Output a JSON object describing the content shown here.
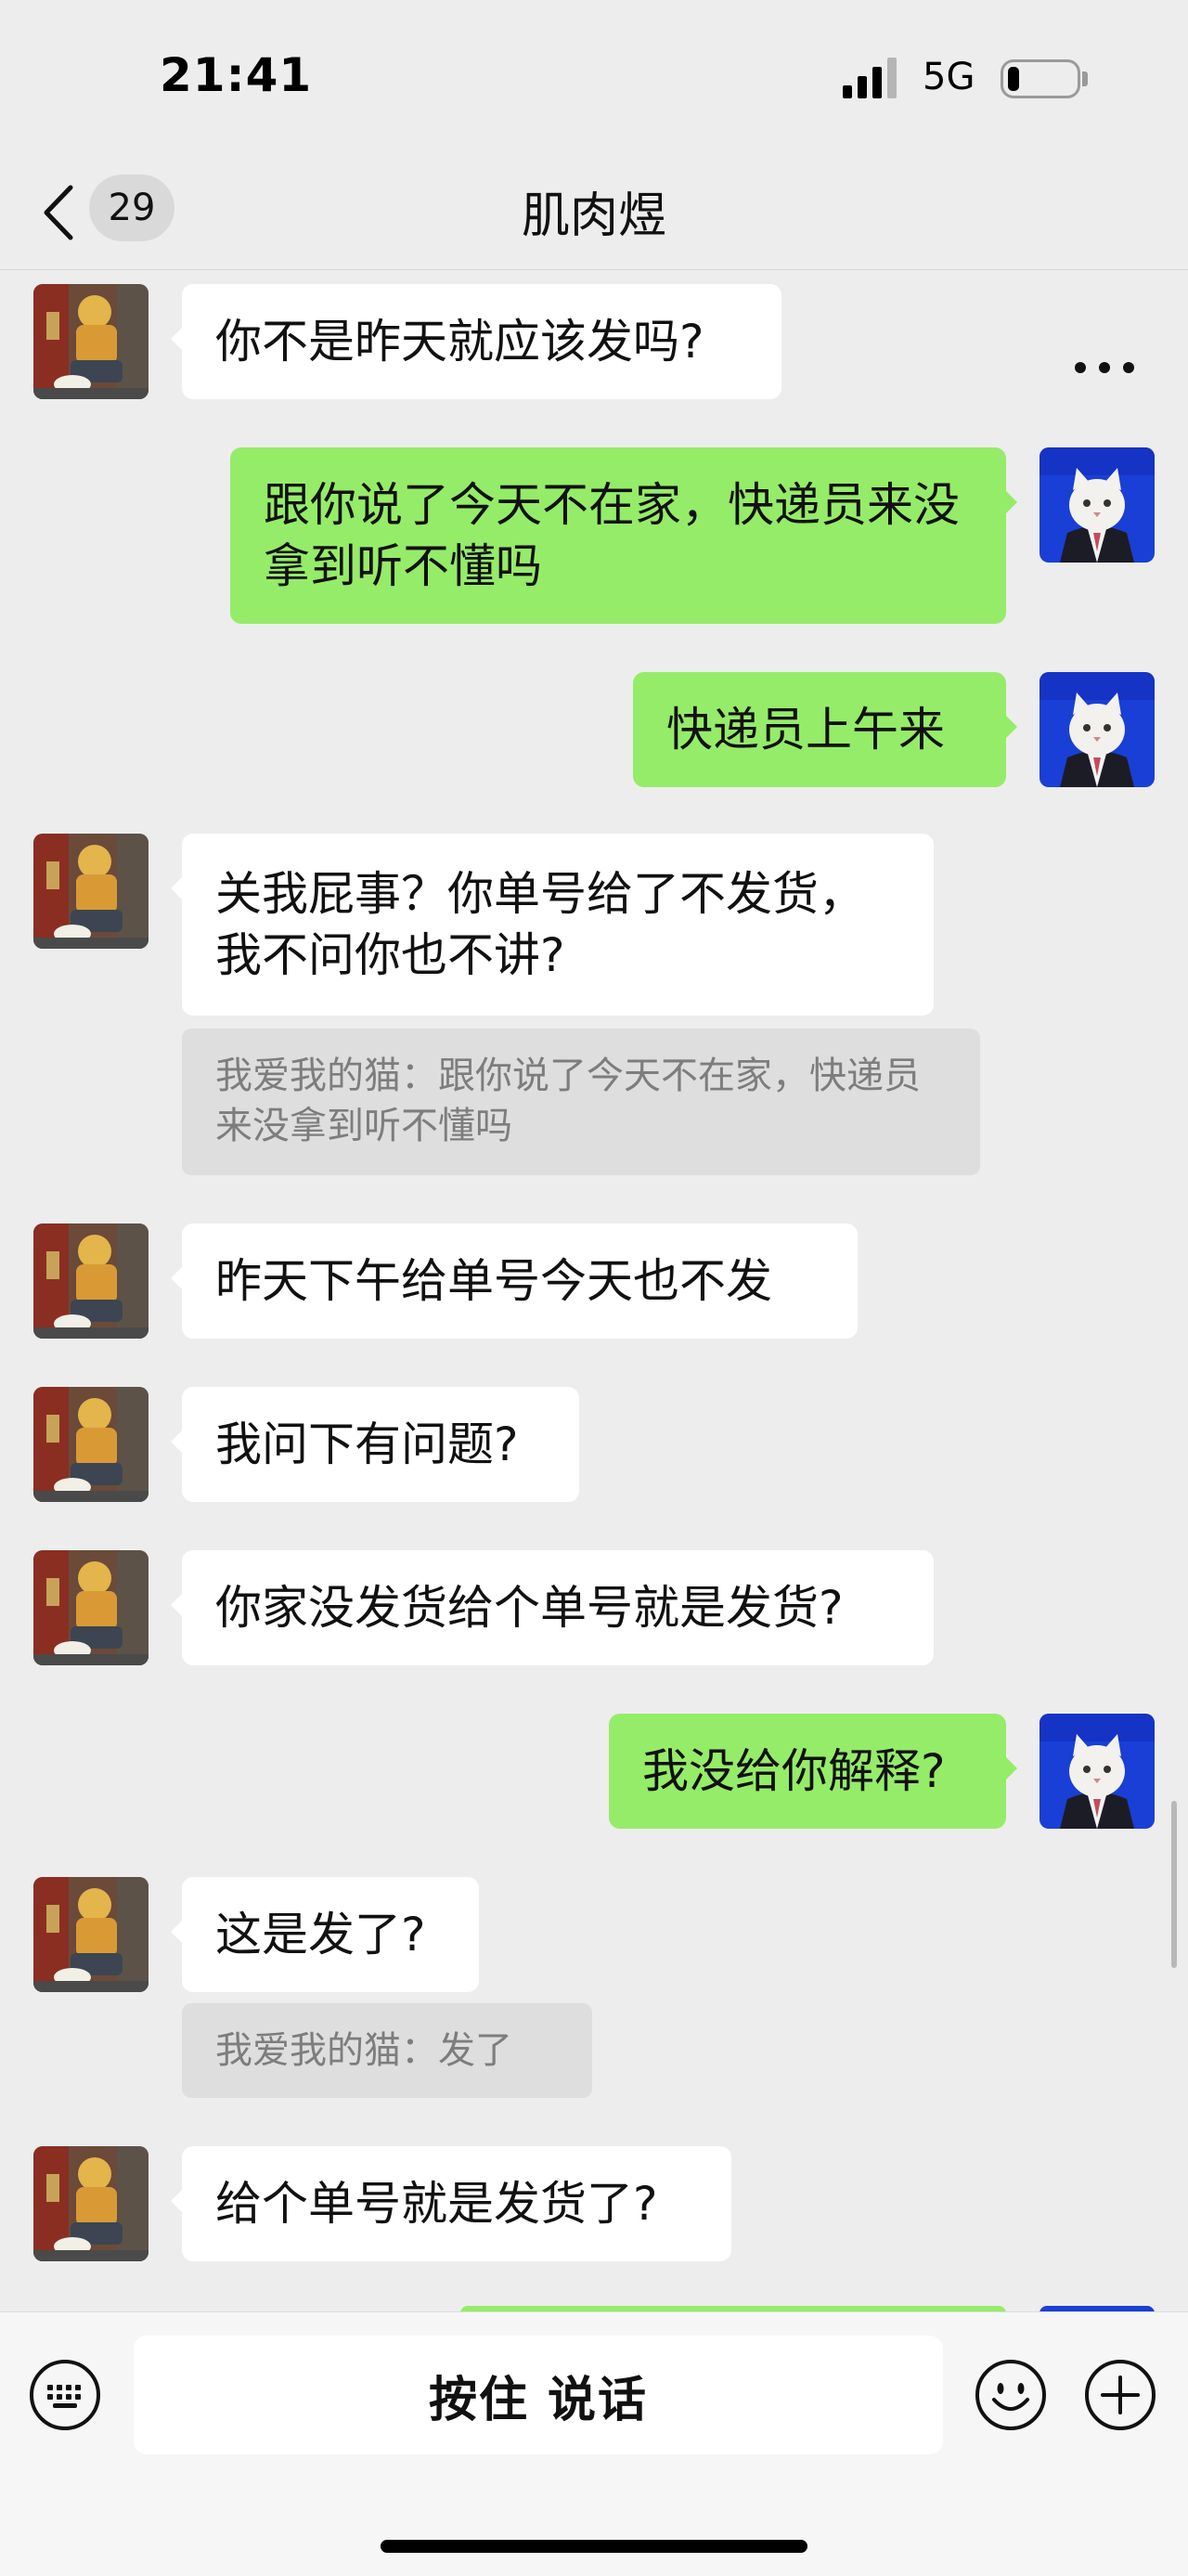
{
  "status_bar": {
    "time": "21:41",
    "network": "5G"
  },
  "nav": {
    "title": "肌肉煜",
    "unread_count": "29"
  },
  "messages": [
    {
      "side": "in",
      "text": "你不是昨天就应该发吗?"
    },
    {
      "side": "out",
      "text": "跟你说了今天不在家，快递员来没拿到听不懂吗"
    },
    {
      "side": "out",
      "text": "快递员上午来"
    },
    {
      "side": "in",
      "text": "关我屁事？你单号给了不发货，我不问你也不讲?",
      "quote": "我爱我的猫：跟你说了今天不在家，快递员来没拿到听不懂吗"
    },
    {
      "side": "in",
      "text": "昨天下午给单号今天也不发"
    },
    {
      "side": "in",
      "text": "我问下有问题?"
    },
    {
      "side": "in",
      "text": "你家没发货给个单号就是发货?"
    },
    {
      "side": "out",
      "text": "我没给你解释?"
    },
    {
      "side": "in",
      "text": "这是发了?",
      "quote": "我爱我的猫：发了"
    },
    {
      "side": "in",
      "text": "给个单号就是发货了?"
    }
  ],
  "input_bar": {
    "hold_to_talk": "按住 说话"
  },
  "colors": {
    "background": "#ededed",
    "outgoing_bubble": "#95ec69",
    "incoming_bubble": "#ffffff",
    "quote_bg": "#dedede"
  },
  "icons": {
    "back": "chevron-left-icon",
    "more": "more-dots-icon",
    "keyboard": "keyboard-icon",
    "emoji": "emoji-icon",
    "plus": "plus-icon",
    "contact_avatar": "person-illustration-avatar",
    "my_avatar": "cat-in-suit-avatar"
  }
}
